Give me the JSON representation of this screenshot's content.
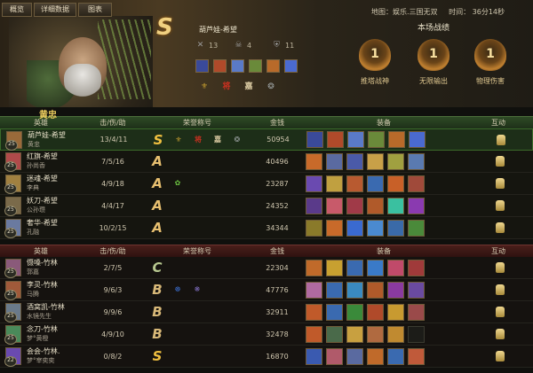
{
  "tabs": [
    "概览",
    "详细数据",
    "图表"
  ],
  "map_info": {
    "map": "地图：娱乐.三国无双",
    "time": "时间： 36分14秒"
  },
  "selected_player": {
    "grade": "S",
    "name": "葫芦娃-希望",
    "kills": "13",
    "deaths": "4",
    "assists": "11",
    "hero": "黄忠"
  },
  "match_stats": {
    "title": "本场战绩",
    "badges": [
      {
        "label": "推塔战神",
        "color": "#c89a48"
      },
      {
        "label": "无限输出",
        "color": "#c89a48"
      },
      {
        "label": "物理伤害",
        "color": "#c89a48"
      }
    ]
  },
  "table_headers": {
    "hero": "英雄",
    "kda": "击/伤/助",
    "honor": "荣誉称号",
    "gold": "金钱",
    "equip": "装备",
    "interact": "互动"
  },
  "team_a": [
    {
      "player": "葫芦娃-希望",
      "hero": "黄忠",
      "level": "25",
      "kda": "13/4/11",
      "grade": "S",
      "honors": [
        {
          "t": "⚜",
          "c": "#c8a030"
        },
        {
          "t": "将",
          "c": "#c83020"
        },
        {
          "t": "嘉",
          "c": "#d8c8a0"
        },
        {
          "t": "❂",
          "c": "#9aa0a0"
        }
      ],
      "gold": "50954",
      "equip": [
        "#3a4a9a",
        "#b04a2a",
        "#5a7ac8",
        "#6a8a3a",
        "#b86a2a",
        "#4a6ad0"
      ],
      "avatar": "#9a6a3a"
    },
    {
      "player": "红旗-希望",
      "hero": "孙尚香",
      "level": "25",
      "kda": "7/5/16",
      "grade": "A",
      "honors": [],
      "gold": "40496",
      "equip": [
        "#c86a2a",
        "#5a6aa0",
        "#4a5aa8",
        "#c8a048",
        "#a0a040",
        "#5a7ab0"
      ],
      "avatar": "#b04a4a"
    },
    {
      "player": "迷魂-希望",
      "hero": "李典",
      "level": "25",
      "kda": "4/9/18",
      "grade": "A",
      "honors": [
        {
          "t": "✿",
          "c": "#6ac040"
        }
      ],
      "gold": "23287",
      "equip": [
        "#6a4ab0",
        "#c0a040",
        "#b85a30",
        "#3a6ab0",
        "#c86028",
        "#a04a3a"
      ],
      "avatar": "#a08040"
    },
    {
      "player": "妖刀-希望",
      "hero": "公孙瓒",
      "level": "25",
      "kda": "4/4/17",
      "grade": "A",
      "honors": [],
      "gold": "24352",
      "equip": [
        "#5a3a8a",
        "#c85a6a",
        "#a03a48",
        "#b05a2a",
        "#3ac0a0",
        "#8a3ab0"
      ],
      "avatar": "#7a6a4a"
    },
    {
      "player": "奢华-希望",
      "hero": "孔融",
      "level": "25",
      "kda": "10/2/15",
      "grade": "A",
      "honors": [],
      "gold": "34344",
      "equip": [
        "#8a7a2a",
        "#c86a2a",
        "#3a6ad0",
        "#4a8ad0",
        "#3a6aa8",
        "#4a8a3a"
      ],
      "avatar": "#6a7aa0"
    }
  ],
  "team_b": [
    {
      "player": "慑嗓-竹林",
      "hero": "郭嘉",
      "level": "25",
      "kda": "2/7/5",
      "grade": "C",
      "honors": [],
      "gold": "22304",
      "equip": [
        "#c06a2a",
        "#c8a030",
        "#3a6ab0",
        "#3a7ac8",
        "#c04a6a",
        "#a03a3a"
      ],
      "avatar": "#8a5a7a"
    },
    {
      "player": "李灵-竹林",
      "hero": "马腾",
      "level": "25",
      "kda": "9/6/3",
      "grade": "B",
      "honors": [
        {
          "t": "☸",
          "c": "#3a6ac8"
        },
        {
          "t": "❋",
          "c": "#7a6ab8"
        }
      ],
      "gold": "47776",
      "equip": [
        "#b06aa0",
        "#3a6ab0",
        "#3a8ac0",
        "#b05a2a",
        "#8a3aa0",
        "#6a4aa0"
      ],
      "avatar": "#a05a3a"
    },
    {
      "player": "酒窝凯-竹林",
      "hero": "水镜先生",
      "level": "25",
      "kda": "9/9/6",
      "grade": "B",
      "honors": [],
      "gold": "32911",
      "equip": [
        "#c05a2a",
        "#3a6ab0",
        "#3a8a3a",
        "#b04a2a",
        "#c89a30",
        "#9a4a4a"
      ],
      "avatar": "#6a7a8a"
    },
    {
      "player": "念刀-竹林",
      "hero": "梦°黄橙",
      "level": "25",
      "kda": "4/9/10",
      "grade": "B",
      "honors": [],
      "gold": "32478",
      "equip": [
        "#c05a2a",
        "#4a6a4a",
        "#c8a040",
        "#b06a40",
        "#c08a30",
        ""
      ],
      "avatar": "#4a8a5a"
    },
    {
      "player": "会会-竹林.",
      "hero": "梦°宰奕奕",
      "level": "22",
      "kda": "0/8/2",
      "grade": "S",
      "honors": [],
      "gold": "16870",
      "equip": [
        "#3a5ab0",
        "#b05a6a",
        "#5a6aa0",
        "#c06a2a",
        "#3a6ab0",
        "#c05a3a"
      ],
      "avatar": "#6a4ab0"
    }
  ]
}
